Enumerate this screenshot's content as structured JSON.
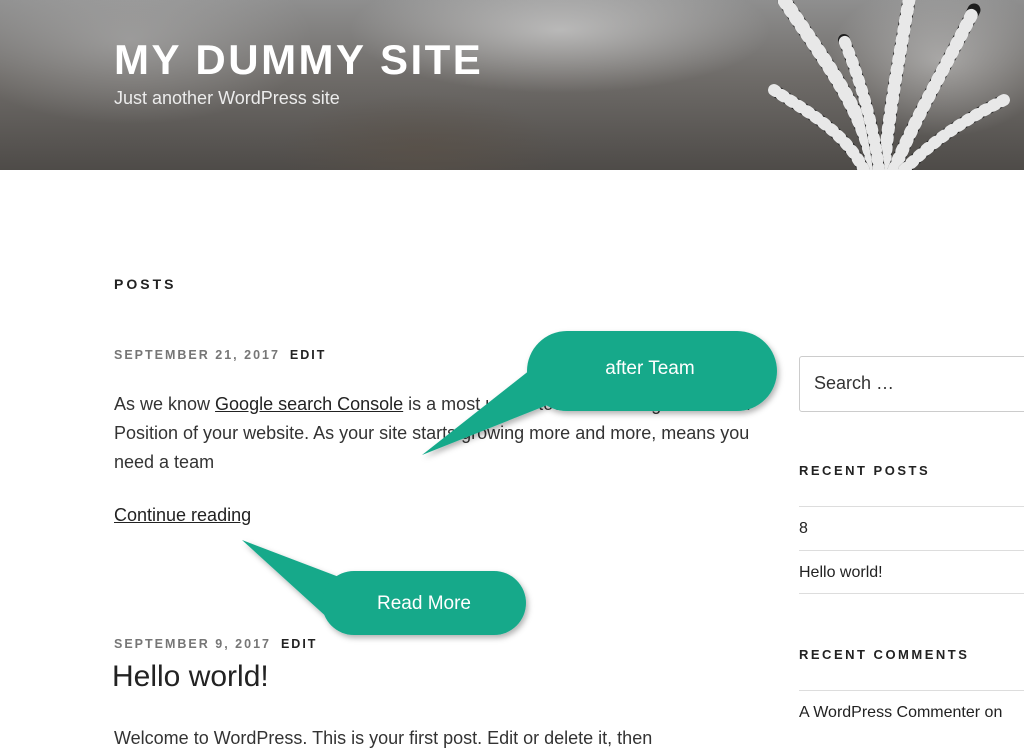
{
  "header": {
    "site_title": "MY DUMMY SITE",
    "site_description": "Just another WordPress site"
  },
  "main": {
    "section_heading": "POSTS",
    "posts": [
      {
        "date": "SEPTEMBER 21, 2017",
        "edit_label": "EDIT",
        "excerpt_before_link": "As we know ",
        "excerpt_link": "Google search Console",
        "excerpt_after_link": " is a most useful tool for tracking the search Position of your website. As your site starts growing more and more, means you need a team",
        "continue_label": "Continue reading"
      },
      {
        "date": "SEPTEMBER 9, 2017",
        "edit_label": "EDIT",
        "title": "Hello world!",
        "content": "Welcome to WordPress. This is your first post. Edit or delete it, then"
      }
    ]
  },
  "sidebar": {
    "search_placeholder": "Search …",
    "recent_posts_title": "RECENT POSTS",
    "recent_posts": [
      "8",
      "Hello world!"
    ],
    "recent_comments_title": "RECENT COMMENTS",
    "recent_comments": [
      "A WordPress Commenter on"
    ]
  },
  "callouts": {
    "team_label": "after Team",
    "read_more_label": "Read More",
    "color": "#14a98a"
  }
}
